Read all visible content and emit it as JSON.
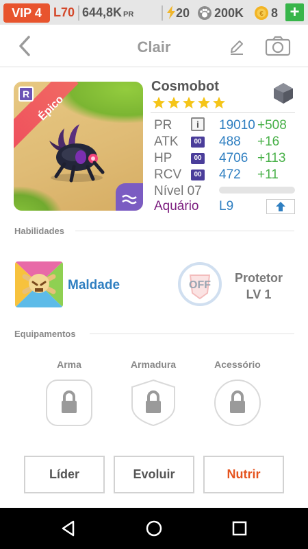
{
  "status_bar": {
    "vip": "VIP 4",
    "level": "L70",
    "power": "644,8K",
    "power_unit": "PR",
    "energy": "20",
    "food": "200K",
    "coins": "8",
    "add_label": "+"
  },
  "header": {
    "title": "Clair",
    "back_icon": "chevron-left-icon",
    "edit_icon": "pencil-icon",
    "camera_icon": "camera-icon"
  },
  "monster": {
    "name": "Cosmobot",
    "rarity_ribbon": "Épico",
    "rarity_letter": "R",
    "stars": 5,
    "element": "stone-gem-icon",
    "stats": [
      {
        "label": "PR",
        "badge": "i",
        "value": "19010",
        "bonus": "+508"
      },
      {
        "label": "ATK",
        "badge": "00",
        "value": "488",
        "bonus": "+16"
      },
      {
        "label": "HP",
        "badge": "00",
        "value": "4706",
        "bonus": "+113"
      },
      {
        "label": "RCV",
        "badge": "00",
        "value": "472",
        "bonus": "+11"
      }
    ],
    "level_label": "Nível 07",
    "xp_fraction": 0.0,
    "habitat": "Aquário",
    "habitat_level": "L9"
  },
  "sections": {
    "skills": "Habilidades",
    "equipment": "Equipamentos"
  },
  "skill": {
    "name": "Maldade",
    "passive_state": "OFF",
    "passive_name": "Protetor",
    "passive_level": "LV 1"
  },
  "equipment": {
    "slots": [
      "Arma",
      "Armadura",
      "Acessório"
    ]
  },
  "actions": {
    "leader": "Líder",
    "evolve": "Evoluir",
    "feed": "Nutrir"
  },
  "colors": {
    "accent_blue": "#2f7fc1",
    "bonus_green": "#47b047",
    "feed_orange": "#e5531e",
    "vip_red": "#e8542d",
    "epic_ribbon": "#ef4d5c"
  }
}
